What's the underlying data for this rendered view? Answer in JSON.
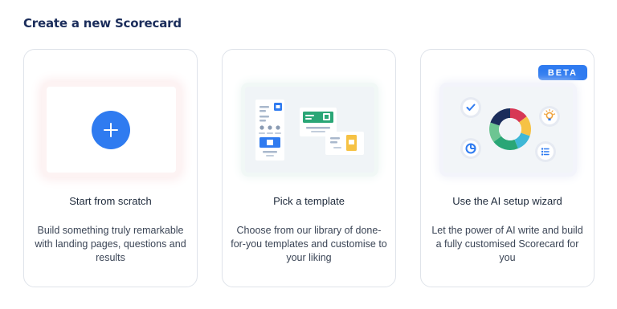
{
  "page": {
    "title": "Create a new Scorecard"
  },
  "cards": [
    {
      "title": "Start from scratch",
      "description": "Build something truly remarkable with landing pages, questions and results",
      "icon": "plus-icon"
    },
    {
      "title": "Pick a template",
      "description": "Choose from our library of done-for-you templates and customise to your liking",
      "icon": "template-illustration"
    },
    {
      "title": "Use the AI setup wizard",
      "description": "Let the power of AI write and build a fully customised Scorecard for you",
      "badge": "BETA",
      "icon": "ai-wizard-illustration"
    }
  ],
  "colors": {
    "accent": "#2f7bf0",
    "title": "#1b2d5b",
    "green": "#2aa676",
    "yellow": "#f6c244"
  }
}
